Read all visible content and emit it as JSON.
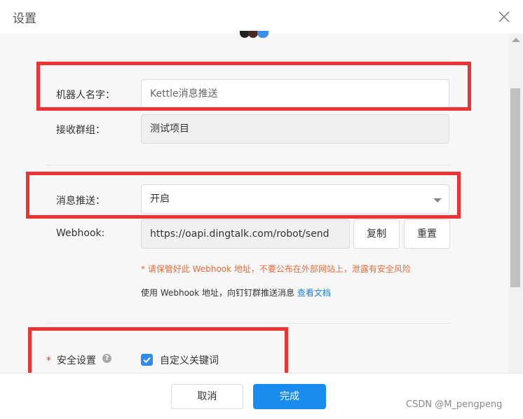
{
  "dialog": {
    "title": "设置"
  },
  "form": {
    "robot_name_label": "机器人名字：",
    "robot_name_placeholder": "Kettle消息推送",
    "group_label": "接收群组：",
    "group_value": "测试项目",
    "push_label": "消息推送：",
    "push_value": "开启",
    "webhook_label": "Webhook:",
    "webhook_value": "https://oapi.dingtalk.com/robot/send",
    "copy_label": "复制",
    "reset_label": "重置",
    "warning_text": "* 请保管好此 Webhook 地址，不要公布在外部网站上，泄露有安全风险",
    "hint_text": "使用 Webhook 地址，向钉钉群推送消息 ",
    "hint_link": "查看文档",
    "security_required_mark": "*",
    "security_label": "安全设置",
    "help_icon_text": "?",
    "keyword_checkbox_label": "自定义关键词",
    "keyword_checked": true
  },
  "footer": {
    "cancel_label": "取消",
    "ok_label": "完成"
  },
  "watermark": "CSDN @M_pengpeng",
  "colors": {
    "primary": "#1a8cf0",
    "checkbox": "#2d8cf0",
    "warning": "#e96a3a",
    "link": "#1d7ee6",
    "annotation_red": "#ef3232",
    "content_bg": "#f7f7f7"
  },
  "icons": {
    "close": "close-icon",
    "help": "question-circle-icon",
    "check": "check-icon",
    "dropdown": "caret-down-icon"
  }
}
